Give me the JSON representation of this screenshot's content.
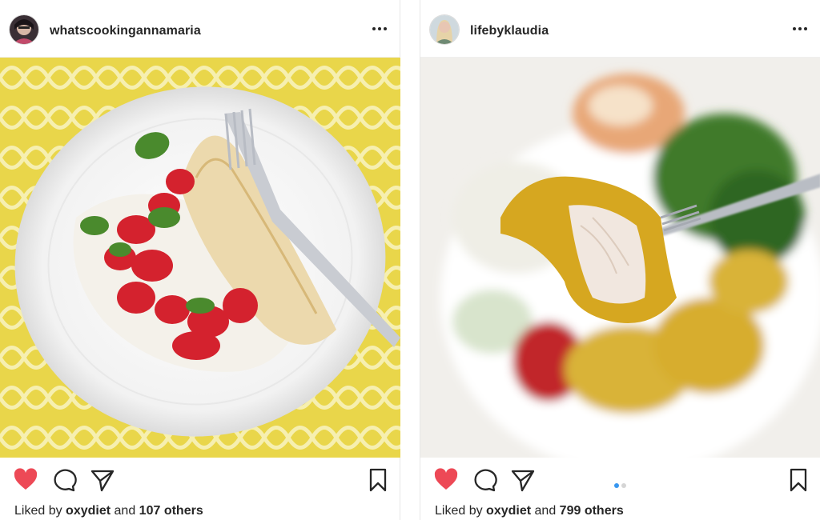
{
  "posts": [
    {
      "username": "whatscookingannamaria",
      "liked_by_prefix": "Liked by",
      "liked_by_user": "oxydiet",
      "liked_by_and": "and",
      "liked_by_others": "107 others",
      "liked": true
    },
    {
      "username": "lifebyklaudia",
      "liked_by_prefix": "Liked by",
      "liked_by_user": "oxydiet",
      "liked_by_and": "and",
      "liked_by_others": "799 others",
      "liked": true,
      "carousel_pages": 2,
      "carousel_active": 1
    }
  ],
  "icons": {
    "like": "heart-icon",
    "comment": "comment-icon",
    "share": "paper-plane-icon",
    "save": "bookmark-icon",
    "more": "more-horizontal-icon"
  },
  "colors": {
    "like_red": "#ed4956",
    "text": "#262626",
    "carousel_active": "#3897f0",
    "carousel_inactive": "#d5d5d5"
  }
}
